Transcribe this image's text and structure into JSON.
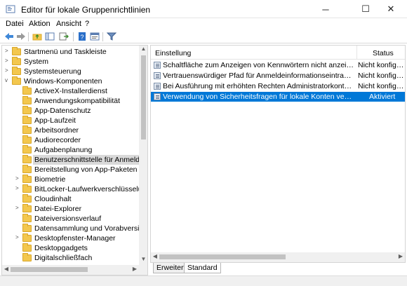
{
  "window": {
    "title": "Editor für lokale Gruppenrichtlinien",
    "minimize_glyph": "─",
    "maximize_glyph": "☐",
    "close_glyph": "✕"
  },
  "menu": {
    "items": [
      "Datei",
      "Aktion",
      "Ansicht",
      "?"
    ]
  },
  "toolbar": {
    "icons": [
      "back-arrow-icon",
      "forward-arrow-icon",
      "folder-up-icon",
      "show-hide-tree-icon",
      "export-list-icon",
      "help-icon",
      "properties-icon",
      "filter-icon"
    ]
  },
  "tree": {
    "items": [
      {
        "label": "Startmenü und Taskleiste",
        "level": 0,
        "expander": ">"
      },
      {
        "label": "System",
        "level": 0,
        "expander": ">"
      },
      {
        "label": "Systemsteuerung",
        "level": 0,
        "expander": ">"
      },
      {
        "label": "Windows-Komponenten",
        "level": 0,
        "expander": "v"
      },
      {
        "label": "ActiveX-Installerdienst",
        "level": 1,
        "expander": ""
      },
      {
        "label": "Anwendungskompatibilität",
        "level": 1,
        "expander": ""
      },
      {
        "label": "App-Datenschutz",
        "level": 1,
        "expander": ""
      },
      {
        "label": "App-Laufzeit",
        "level": 1,
        "expander": ""
      },
      {
        "label": "Arbeitsordner",
        "level": 1,
        "expander": ""
      },
      {
        "label": "Audiorecorder",
        "level": 1,
        "expander": ""
      },
      {
        "label": "Aufgabenplanung",
        "level": 1,
        "expander": ""
      },
      {
        "label": "Benutzerschnittstelle für Anmeldeinfo",
        "level": 1,
        "expander": "",
        "selected": true
      },
      {
        "label": "Bereitstellung von App-Paketen",
        "level": 1,
        "expander": ""
      },
      {
        "label": "Biometrie",
        "level": 1,
        "expander": ">"
      },
      {
        "label": "BitLocker-Laufwerkverschlüsselung",
        "level": 1,
        "expander": ">"
      },
      {
        "label": "Cloudinhalt",
        "level": 1,
        "expander": ""
      },
      {
        "label": "Datei-Explorer",
        "level": 1,
        "expander": ">"
      },
      {
        "label": "Dateiversionsverlauf",
        "level": 1,
        "expander": ""
      },
      {
        "label": "Datensammlung und Vorabversionen",
        "level": 1,
        "expander": ""
      },
      {
        "label": "Desktopfenster-Manager",
        "level": 1,
        "expander": ">"
      },
      {
        "label": "Desktopgadgets",
        "level": 1,
        "expander": ""
      },
      {
        "label": "Digitalschließfach",
        "level": 1,
        "expander": ""
      }
    ]
  },
  "list": {
    "columns": {
      "setting": "Einstellung",
      "status": "Status"
    },
    "rows": [
      {
        "name": "Schaltfläche zum Anzeigen von Kennwörtern nicht anzeigen",
        "status": "Nicht konfiguri..."
      },
      {
        "name": "Vertrauenswürdiger Pfad für Anmeldeinformationseintrag erforder...",
        "status": "Nicht konfiguri..."
      },
      {
        "name": "Bei Ausführung mit erhöhten Rechten Administratorkonten auflist...",
        "status": "Nicht konfiguri..."
      },
      {
        "name": "Verwendung von Sicherheitsfragen für lokale Konten verhindern",
        "status": "Aktiviert",
        "selected": true
      }
    ]
  },
  "tabs": [
    "Erweitert",
    "Standard"
  ],
  "colors": {
    "selection": "#0078d7",
    "folder": "#f3c74e"
  }
}
